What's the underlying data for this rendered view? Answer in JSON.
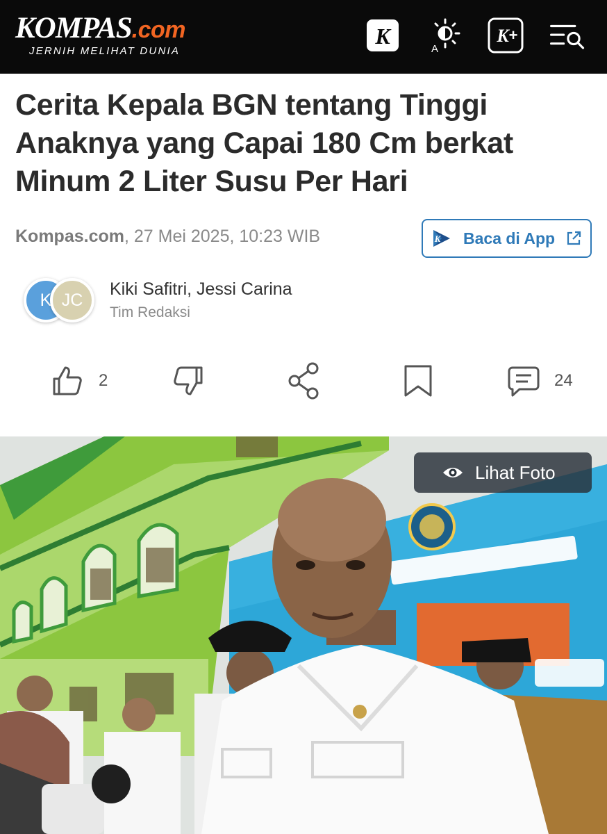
{
  "header": {
    "logo_main": "KOMPAS",
    "logo_suffix": ".com",
    "logo_tagline": "JERNIH MELIHAT DUNIA",
    "icons": [
      "k-app-icon",
      "brightness-icon",
      "kplus-icon",
      "menu-search-icon"
    ]
  },
  "article": {
    "title": "Cerita Kepala BGN tentang Tinggi Anaknya yang Capai 180 Cm berkat Minum 2 Liter Susu Per Hari",
    "source": "Kompas.com",
    "datetime": ", 27 Mei 2025, 10:23 WIB",
    "app_button_label": "Baca di App"
  },
  "authors": {
    "avatar_1": "K",
    "avatar_2": "JC",
    "names": "Kiki Safitri,  Jessi Carina",
    "team": "Tim Redaksi"
  },
  "actions": {
    "like_count": "2",
    "comment_count": "24"
  },
  "photo": {
    "view_label": "Lihat Foto"
  },
  "colors": {
    "header_bg": "#0a0a0a",
    "accent_orange": "#f26522",
    "link_blue": "#2f7ab8"
  }
}
